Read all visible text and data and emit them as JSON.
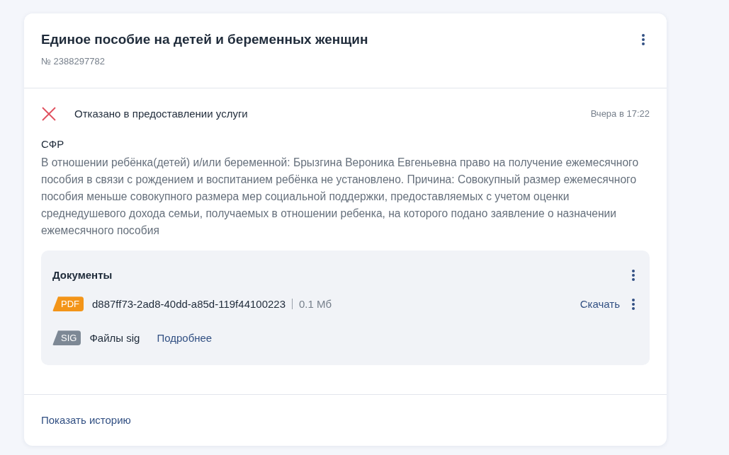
{
  "card": {
    "title": "Единое пособие на детей и беременных женщин",
    "number": "№ 2388297782"
  },
  "status": {
    "kind": "rejected",
    "text": "Отказано в предоставлении услуги",
    "time": "Вчера в 17:22"
  },
  "agency": "СФР",
  "description": "В отношении ребёнка(детей) и/или беременной: Брызгина Вероника Евгеньевна право на получение ежемесячного пособия в связи с рождением и воспитанием ребёнка не установлено. Причина: Совокупный размер ежемесячного пособия меньше совокупного размера мер социальной поддержки, предоставляемых с учетом оценки среднедушевого дохода семьи, получаемых в отношении ребенка, на которого подано заявление о назначении ежемесячного пособия",
  "documents": {
    "title": "Документы",
    "files": [
      {
        "kind": "pdf",
        "badge": "PDF",
        "name": "d887ff73-2ad8-40dd-a85d-119f44100223",
        "size": "0.1 Мб",
        "action": "Скачать"
      },
      {
        "kind": "sig",
        "badge": "SIG",
        "name": "Файлы sig",
        "link": "Подробнее"
      }
    ]
  },
  "history_link": "Показать историю"
}
